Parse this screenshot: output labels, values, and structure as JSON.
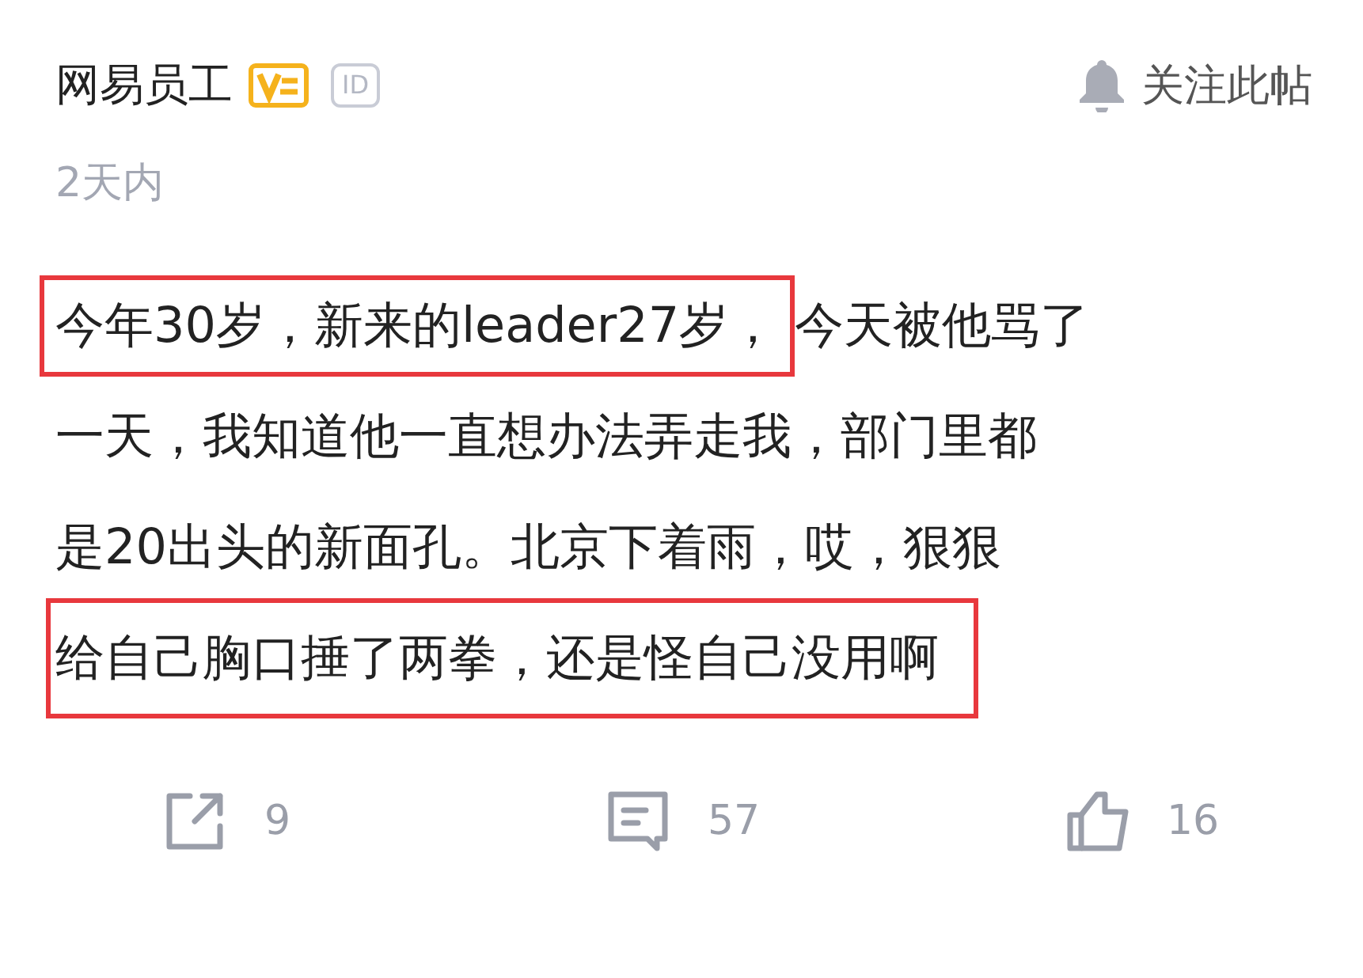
{
  "post": {
    "author": "网易员工",
    "verified": true,
    "id_badge": "ID",
    "follow_label": "关注此帖",
    "time": "2天内",
    "lines": [
      {
        "segments": [
          {
            "text": "今年30岁，新来的leader27岁，",
            "highlighted": true
          },
          {
            "text": "今天被他骂了",
            "highlighted": false
          }
        ]
      },
      {
        "segments": [
          {
            "text": "一天，我知道他一直想办法弄走我，部门里都",
            "highlighted": false
          }
        ]
      },
      {
        "segments": [
          {
            "text": "是20出头的新面孔。北京下着雨，哎，狠狠",
            "highlighted": false
          }
        ]
      },
      {
        "segments": [
          {
            "text": "给自己胸口捶了两拳，还是怪自己没用啊",
            "highlighted": true
          }
        ]
      }
    ],
    "actions": [
      {
        "kind": "share",
        "count": "9"
      },
      {
        "kind": "comment",
        "count": "57"
      },
      {
        "kind": "like",
        "count": "16"
      }
    ]
  }
}
